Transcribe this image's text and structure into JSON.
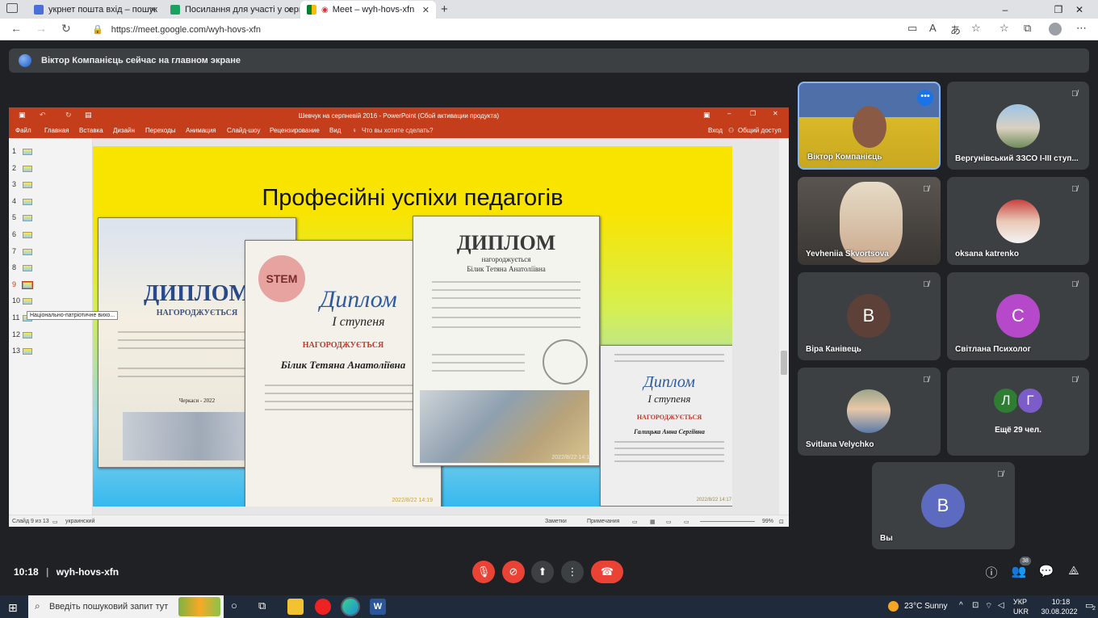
{
  "browser": {
    "tabs": [
      {
        "label": "укрнет пошта вхід – пошук",
        "favicon": "search-icon"
      },
      {
        "label": "Посилання для участі у серпнев",
        "favicon": "doc-icon"
      },
      {
        "label": "Meet – wyh-hovs-xfn",
        "favicon": "meet-icon"
      }
    ],
    "url": "https://meet.google.com/wyh-hovs-xfn"
  },
  "meet": {
    "banner": "Віктор Компанієць сейчас на главном экране",
    "meeting_code": "wyh-hovs-xfn",
    "time": "10:18",
    "participants_count": "38",
    "participants": [
      {
        "name": "Віктор Компанієць",
        "kind": "video"
      },
      {
        "name": "Вергунівський ЗЗСО І-ІІІ ступ...",
        "kind": "photo"
      },
      {
        "name": "Yevheniia Skvortsova",
        "kind": "video"
      },
      {
        "name": "oksana katrenko",
        "kind": "photo"
      },
      {
        "name": "Віра Канівець",
        "initial": "В",
        "color": "#5d4037"
      },
      {
        "name": "Світлана Психолог",
        "initial": "С",
        "color": "#b549c9"
      },
      {
        "name": "Svitlana Velychko",
        "kind": "photo"
      },
      {
        "name": "Ещё 29 чел.",
        "initials": [
          "Л",
          "Г"
        ],
        "colors": [
          "#2e7d32",
          "#7b5cc9"
        ]
      },
      {
        "name": "Вы",
        "initial": "В",
        "color": "#5c6bc0"
      }
    ]
  },
  "ppt": {
    "window_title": "Шевчук на серпневій 2016 - PowerPoint (Сбой активации продукта)",
    "menu": [
      "Файл",
      "Главная",
      "Вставка",
      "Дизайн",
      "Переходы",
      "Анимация",
      "Слайд-шоу",
      "Рецензирование",
      "Вид"
    ],
    "tellme": "Что вы хотите сделать?",
    "login": "Вход",
    "share": "Общий доступ",
    "slide_numbers": [
      "1",
      "2",
      "3",
      "4",
      "5",
      "6",
      "7",
      "8",
      "9",
      "10",
      "11",
      "12",
      "13"
    ],
    "tooltip": "Національно-патріотичне вихо...",
    "slide_title": "Професійні успіхи педагогів",
    "status_left": "Слайд 9 из 13",
    "status_lang": "украинский",
    "status_notes": "Заметки",
    "status_comments": "Примечания",
    "zoom": "99%",
    "diplomas": [
      {
        "heading": "ДИПЛОМ",
        "sub": "НАГОРОДЖУЄТЬСЯ",
        "place": "Черкаси - 2022"
      },
      {
        "heading": "Диплом",
        "sub": "І ступеня",
        "award": "НАГОРОДЖУЄТЬСЯ",
        "name": "Білик Тетяна Анатоліївна",
        "timestamp": "2022/8/22 14:19"
      },
      {
        "heading": "ДИПЛОМ",
        "sub": "нагороджується",
        "name": "Білик Тетяна Анатоліївна",
        "timestamp": "2022/8/22 14:10"
      },
      {
        "heading": "Диплом",
        "sub": "І ступеня",
        "award": "НАГОРОДЖУЄТЬСЯ",
        "name": "Галицька Анна Сергіївна",
        "timestamp": "2022/8/22 14:17"
      }
    ]
  },
  "taskbar": {
    "search_placeholder": "Введіть пошуковий запит тут",
    "weather": "23°C  Sunny",
    "lang": "УКР",
    "lang2": "UKR",
    "time": "10:18",
    "date": "30.08.2022",
    "notif": "2"
  }
}
